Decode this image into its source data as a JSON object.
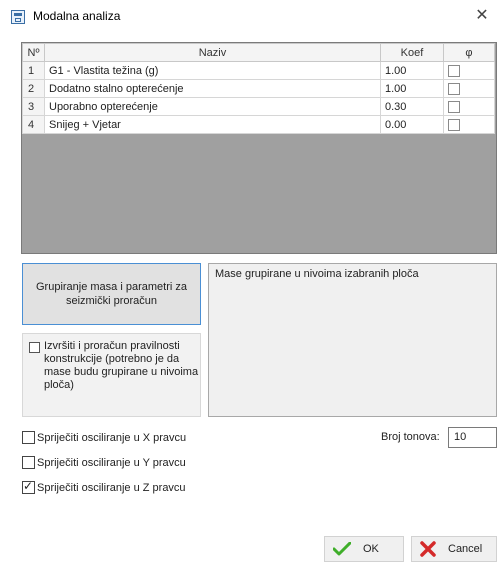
{
  "window": {
    "title": "Modalna analiza",
    "close": "✕"
  },
  "grid": {
    "columns": [
      "Nº",
      "Naziv",
      "Koef",
      "φ"
    ],
    "rows": [
      {
        "no": "1",
        "naziv": "G1 - Vlastita težina (g)",
        "koef": "1.00",
        "phi": false
      },
      {
        "no": "2",
        "naziv": "Dodatno stalno opterećenje",
        "koef": "1.00",
        "phi": false
      },
      {
        "no": "3",
        "naziv": "Uporabno opterećenje",
        "koef": "0.30",
        "phi": false
      },
      {
        "no": "4",
        "naziv": "Snijeg + Vjetar",
        "koef": "0.00",
        "phi": false
      }
    ]
  },
  "group_button": "Grupiranje  masa i parametri za seizmički proračun",
  "regularity_check": {
    "label": "Izvršiti i proračun pravilnosti konstrukcije (potrebno je da mase budu grupirane u nivoima ploča)",
    "checked": false
  },
  "memo_text": "Mase grupirane u nivoima izabranih ploča",
  "oscillation": [
    {
      "label": "Spriječiti osciliranje u X pravcu",
      "checked": false
    },
    {
      "label": "Spriječiti osciliranje u Y pravcu",
      "checked": false
    },
    {
      "label": "Spriječiti osciliranje u Z pravcu",
      "checked": true
    }
  ],
  "broj_tonova": {
    "label": "Broj tonova:",
    "value": "10"
  },
  "buttons": {
    "ok": "OK",
    "cancel": "Cancel"
  },
  "colors": {
    "ok_icon": "#3fae2a",
    "cancel_icon": "#d42a2a",
    "grid_empty": "#a0a0a0"
  }
}
